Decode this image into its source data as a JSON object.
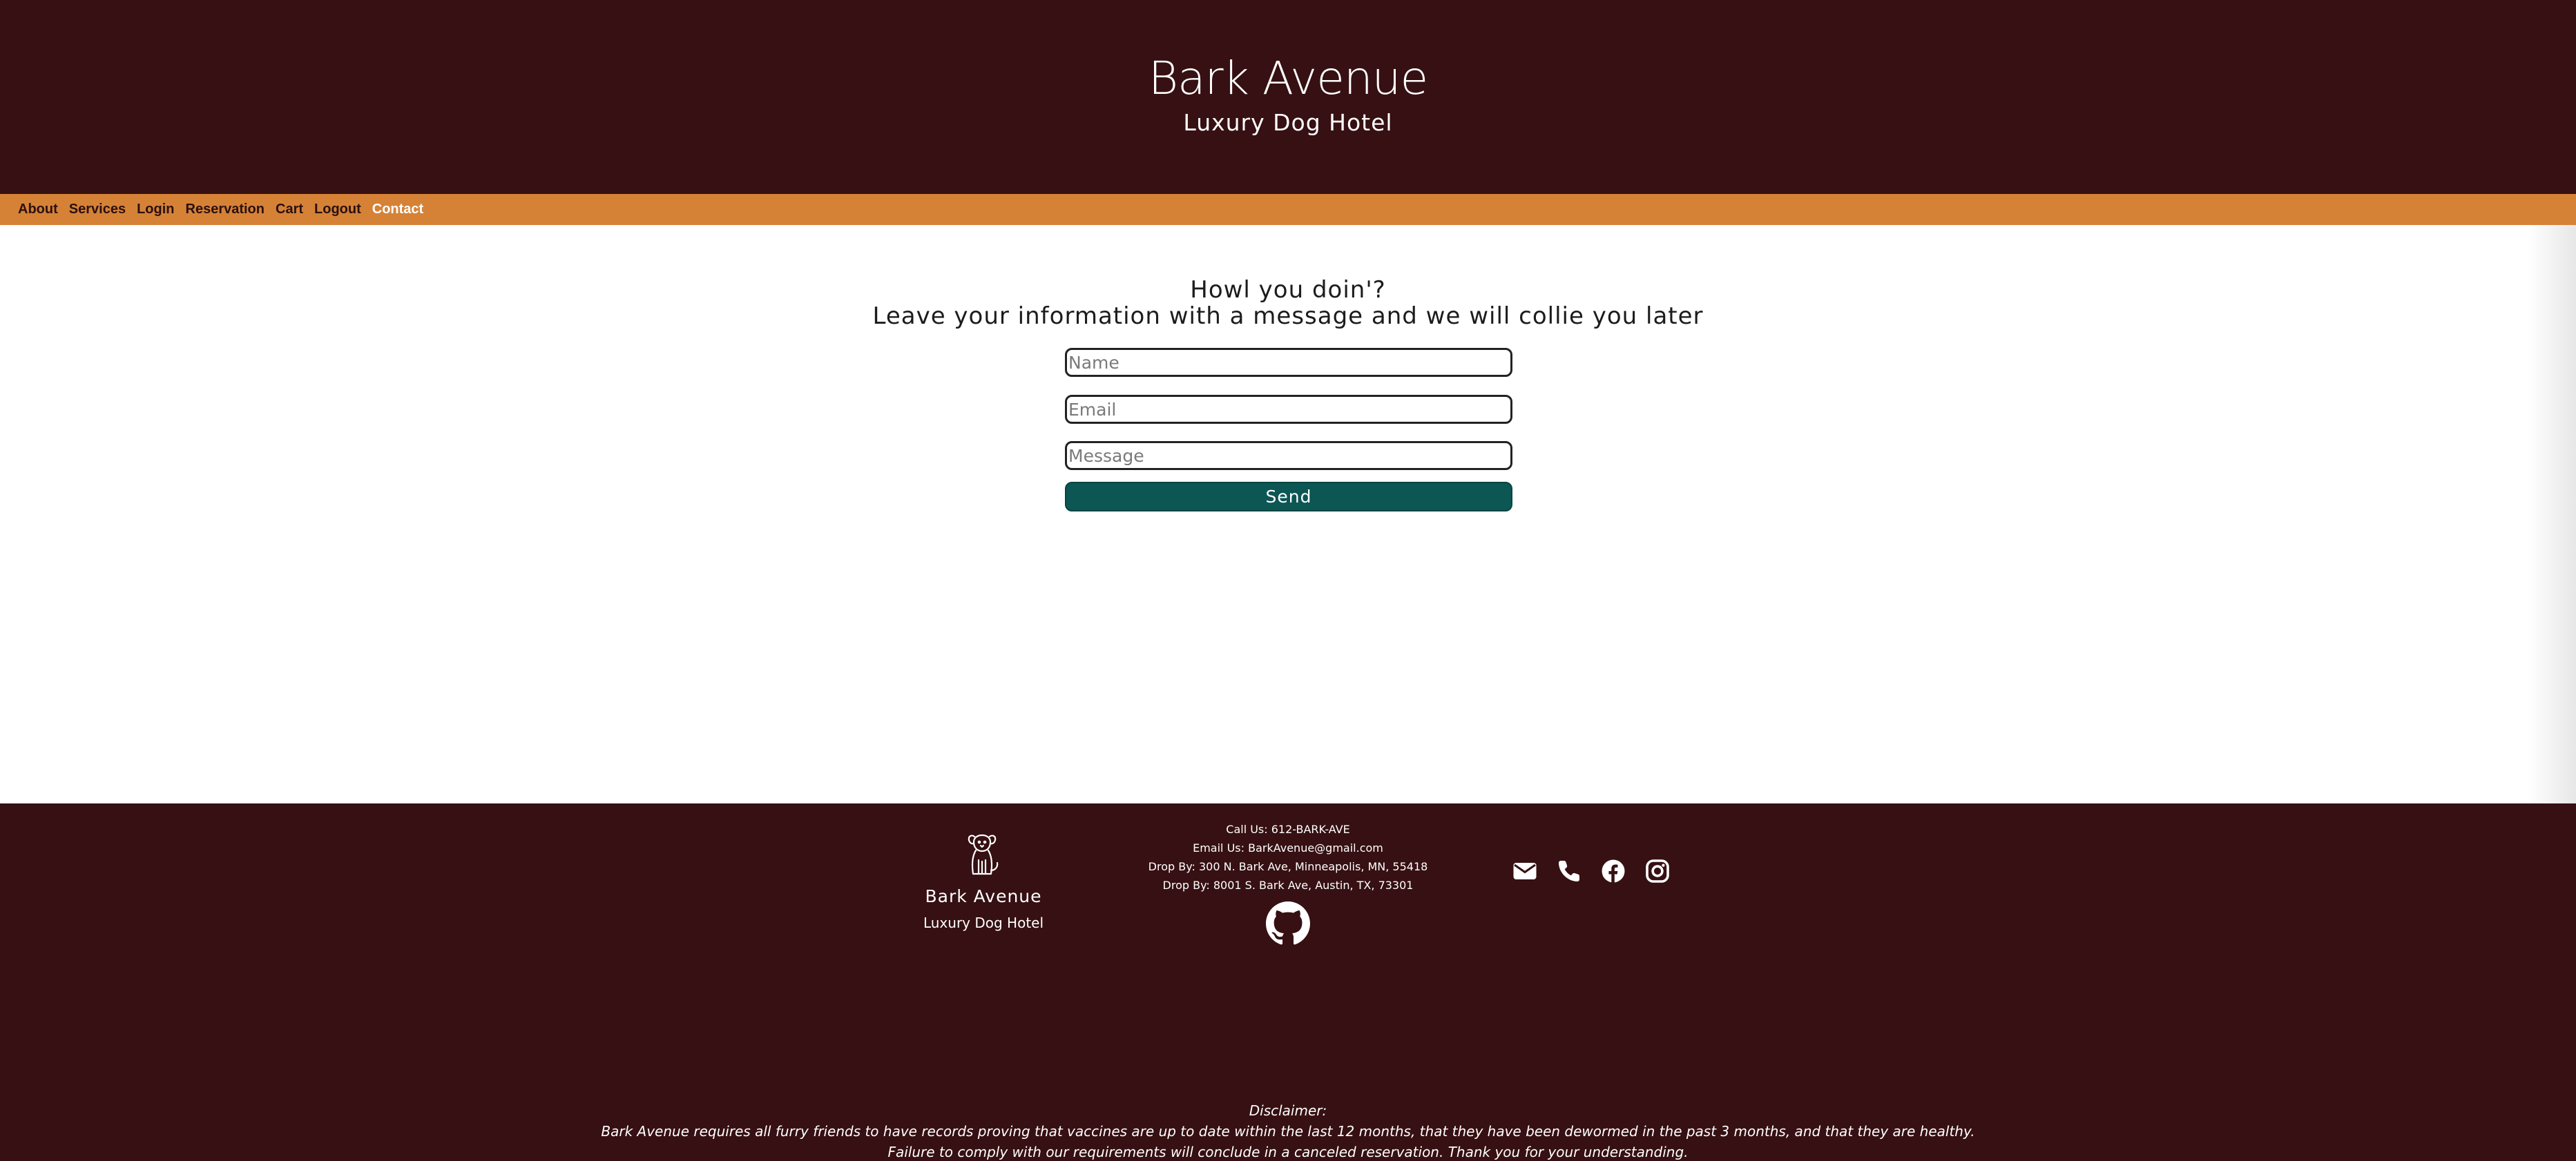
{
  "header": {
    "title": "Bark Avenue",
    "subtitle": "Luxury Dog Hotel"
  },
  "nav": {
    "items": [
      {
        "label": "About"
      },
      {
        "label": "Services"
      },
      {
        "label": "Login"
      },
      {
        "label": "Reservation"
      },
      {
        "label": "Cart"
      },
      {
        "label": "Logout"
      },
      {
        "label": "Contact",
        "active": true
      }
    ]
  },
  "main": {
    "heading_line1": "Howl you doin'?",
    "heading_line2": "Leave your information with a message and we will collie you later",
    "form": {
      "name_placeholder": "Name",
      "email_placeholder": "Email",
      "message_placeholder": "Message",
      "name_value": "",
      "email_value": "",
      "message_value": "",
      "send_label": "Send"
    }
  },
  "footer": {
    "brand_name": "Bark Avenue",
    "brand_sub": "Luxury Dog Hotel",
    "contact": {
      "call": "Call Us: 612-BARK-AVE",
      "email": "Email Us: BarkAvenue@gmail.com",
      "drop1": "Drop By: 300 N. Bark Ave, Minneapolis, MN, 55418",
      "drop2": "Drop By: 8001 S. Bark Ave, Austin, TX, 73301"
    },
    "icons": [
      "dog-logo-icon",
      "github-icon",
      "envelope-icon",
      "phone-icon",
      "facebook-icon",
      "instagram-icon"
    ],
    "disclaimer": {
      "title": "Disclaimer:",
      "line1": "Bark Avenue requires all furry friends to have records proving that vaccines are up to date within the last 12 months, that they have been dewormed in the past 3 months, and that they are healthy.",
      "line2": "Failure to comply with our requirements will conclude in a canceled reservation. Thank you for your understanding."
    }
  },
  "colors": {
    "header_bg": "#361012",
    "nav_bg": "#d68236",
    "button_bg": "#0c5654",
    "active_nav_text": "#ffffff"
  }
}
